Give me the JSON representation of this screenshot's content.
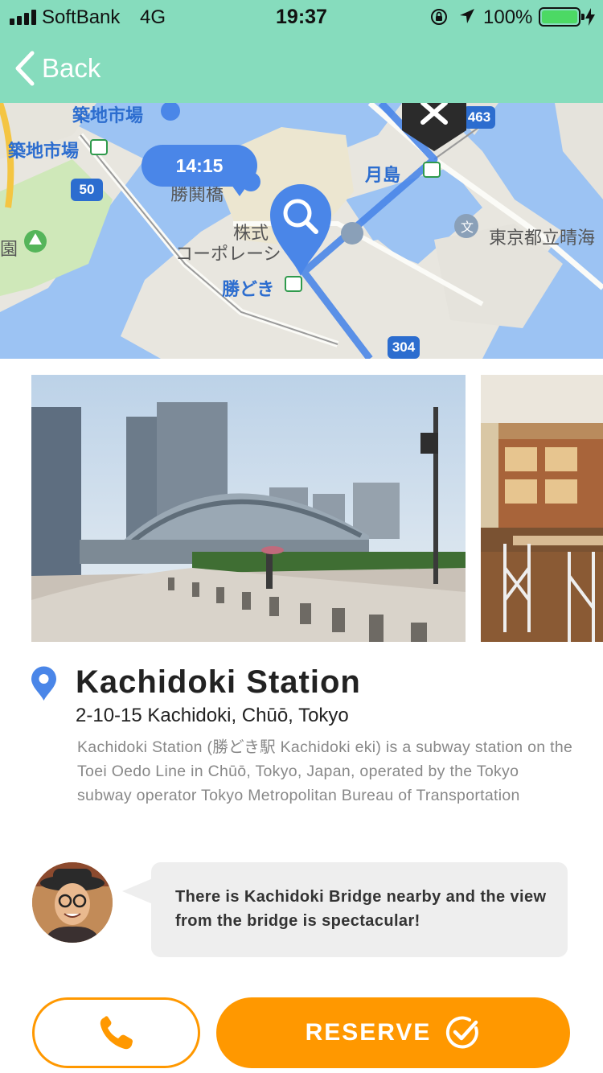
{
  "status_bar": {
    "carrier": "SoftBank",
    "network": "4G",
    "time": "19:37",
    "battery": "100%",
    "battery_level": 1.0,
    "icons": [
      "signal-icon",
      "orientation-lock-icon",
      "location-arrow-icon",
      "battery-icon",
      "charging-icon"
    ]
  },
  "nav": {
    "back_label": "Back",
    "bar_color": "#86dcbd"
  },
  "map": {
    "time_bubble": "14:15",
    "labels": {
      "tsukiji_market_top": "築地市場",
      "tsukiji_market": "築地市場",
      "kachidokibashi": "勝鬨橋",
      "tsukishima": "月島",
      "kabushiki": "株式",
      "corporation": "コーポレーシ",
      "kachidoki": "勝どき",
      "harumi": "東京都立晴海",
      "park": "園"
    },
    "route_numbers": {
      "r50": "50",
      "r463": "463",
      "r304": "304"
    },
    "route_color": "#4a86e8",
    "icons": [
      "search-pin-icon",
      "destination-pin-icon",
      "subway-station-icon",
      "park-icon",
      "school-icon"
    ]
  },
  "gallery": {
    "photos": [
      "kachidoki-bridge-photo",
      "cafe-interior-photo"
    ]
  },
  "place": {
    "name": "Kachidoki Station",
    "address": "2-10-15 Kachidoki, Chūō, Tokyo",
    "description": "Kachidoki Station (勝どき駅 Kachidoki eki) is a subway station on the Toei Oedo Line in Chūō, Tokyo, Japan, operated by the Tokyo subway operator Tokyo Metropolitan Bureau of Transportation",
    "pin_color": "#4a86e8"
  },
  "comment": {
    "text": "There is Kachidoki Bridge nearby and the view from the bridge is spectacular!"
  },
  "actions": {
    "call_icon": "phone-icon",
    "reserve_label": "RESERVE",
    "reserve_icon": "check-circle-icon",
    "accent_color": "#ff9800"
  }
}
